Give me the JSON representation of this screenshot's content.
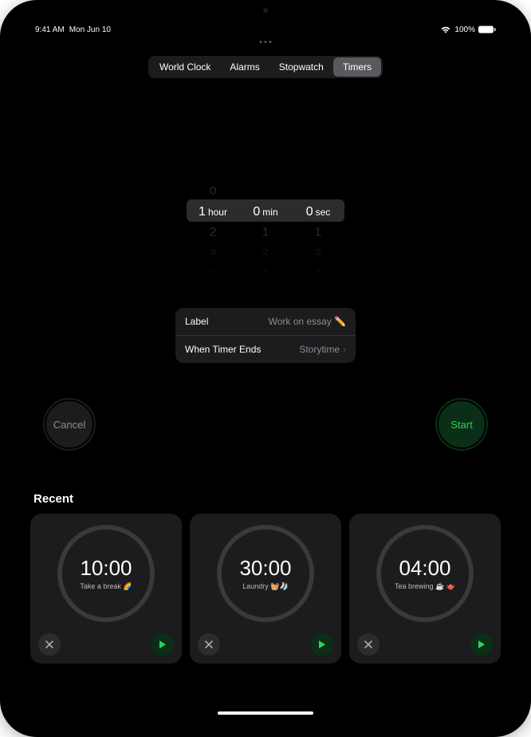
{
  "status": {
    "time": "9:41 AM",
    "date": "Mon Jun 10",
    "battery": "100%"
  },
  "tabs": {
    "world_clock": "World Clock",
    "alarms": "Alarms",
    "stopwatch": "Stopwatch",
    "timers": "Timers"
  },
  "picker": {
    "hour_above": "0",
    "hour_sel": "1",
    "hour_unit": "hour",
    "hour_b1": "2",
    "hour_b2": "3",
    "hour_b3": "4",
    "min_sel": "0",
    "min_unit": "min",
    "min_b1": "1",
    "min_b2": "2",
    "min_b3": "3",
    "sec_sel": "0",
    "sec_unit": "sec",
    "sec_b1": "1",
    "sec_b2": "2",
    "sec_b3": "3"
  },
  "settings": {
    "label_title": "Label",
    "label_value": "Work on essay ✏️",
    "ends_title": "When Timer Ends",
    "ends_value": "Storytime"
  },
  "buttons": {
    "cancel": "Cancel",
    "start": "Start"
  },
  "recent": {
    "title": "Recent",
    "cards": [
      {
        "time": "10:00",
        "label": "Take a break 🌈"
      },
      {
        "time": "30:00",
        "label": "Laundry 🧺🧦"
      },
      {
        "time": "04:00",
        "label": "Tea brewing ☕️ 🫖"
      }
    ]
  }
}
